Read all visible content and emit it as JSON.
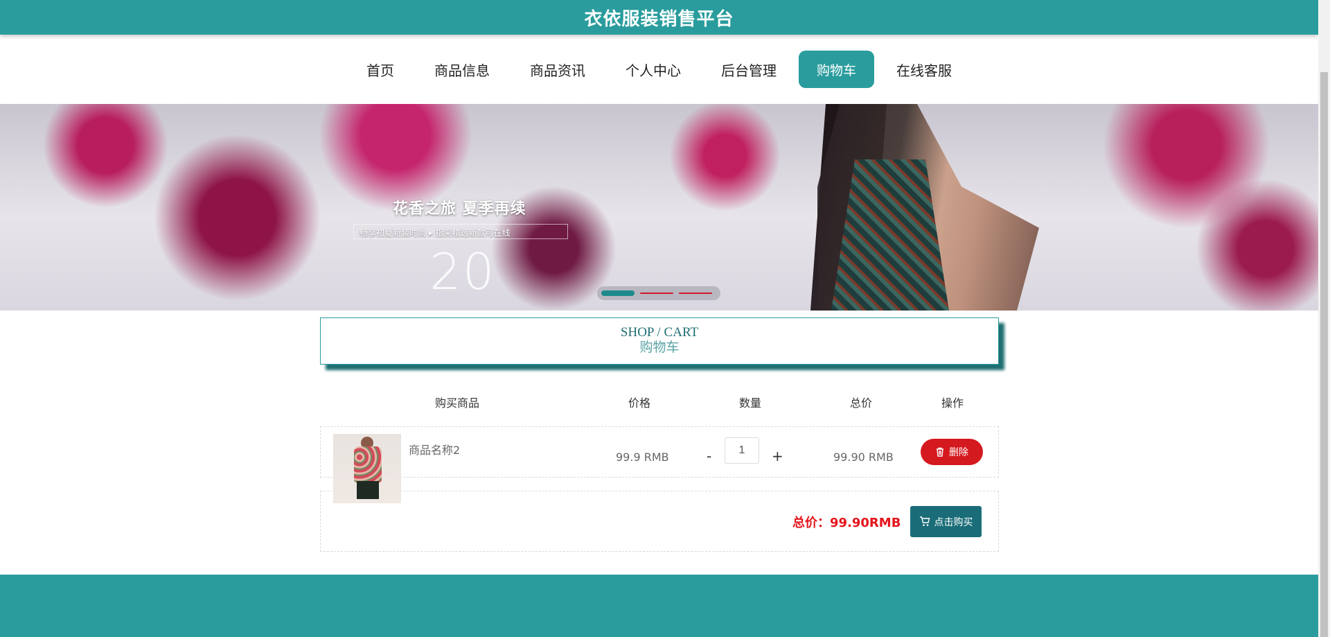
{
  "header": {
    "title": "衣依服装销售平台"
  },
  "nav": {
    "items": [
      {
        "label": "首页"
      },
      {
        "label": "商品信息"
      },
      {
        "label": "商品资讯"
      },
      {
        "label": "个人中心"
      },
      {
        "label": "后台管理"
      },
      {
        "label": "购物车",
        "active": true
      },
      {
        "label": "在线客服"
      }
    ]
  },
  "banner": {
    "slogan_title": "花香之旅 夏季再续",
    "slogan_sub": "畅享初夏新装时尚 ▸ 指尖精选新款可在线",
    "year": "20",
    "slides_total": 3,
    "slides_active": 1
  },
  "heading": {
    "en": "SHOP / CART",
    "cn": "购物车"
  },
  "table": {
    "columns": [
      "购买商品",
      "价格",
      "数量",
      "总价",
      "操作"
    ]
  },
  "cart": {
    "items": [
      {
        "name": "商品名称2",
        "price": "99.9 RMB",
        "quantity": "1",
        "subtotal": "99.90 RMB",
        "delete_label": "删除",
        "minus": "-",
        "plus": "+"
      }
    ],
    "total_label": "总价：",
    "total_value": "99.90RMB",
    "buy_label": "点击购买"
  },
  "colors": {
    "primary": "#2a9c9d",
    "danger": "#d4191f",
    "buy": "#1a6d78",
    "total": "#e3151b"
  }
}
